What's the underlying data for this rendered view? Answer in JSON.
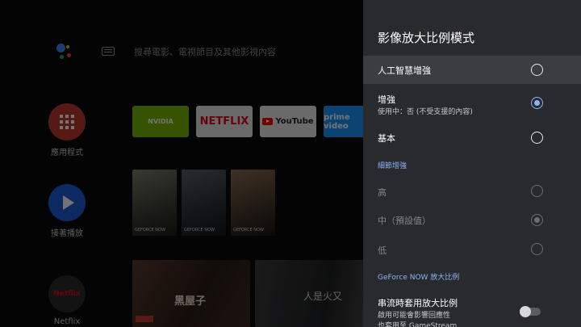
{
  "home": {
    "search_hint": "搜尋電影、電視節目及其他影視內容",
    "side_items": [
      {
        "label": "應用程式",
        "icon": "apps-grid-icon",
        "color": "#c0392b"
      },
      {
        "label": "接著播放",
        "icon": "play-icon",
        "color": "#1e5bd8"
      },
      {
        "label": "Netflix",
        "icon": "netflix-logo-icon",
        "color": "#2a2a2a"
      }
    ],
    "apps": {
      "nvidia": "NVIDIA",
      "netflix": "NETFLIX",
      "youtube": "YouTube",
      "prime": "prime video"
    },
    "games": [
      {
        "badge": "GEFORCE NOW"
      },
      {
        "badge": "GEFORCE NOW"
      },
      {
        "badge": "GEFORCE NOW"
      }
    ],
    "movies": [
      {
        "caption": "黑屋子"
      },
      {
        "caption": "人是火又"
      }
    ]
  },
  "panel": {
    "title": "影像放大比例模式",
    "options": [
      {
        "label": "人工智慧增強",
        "checked": false
      },
      {
        "label": "增強",
        "sub": "使用中：否 (不受支援的內容)",
        "checked": true
      },
      {
        "label": "基本",
        "checked": false
      }
    ],
    "detail_section": {
      "header": "細節增強",
      "options": [
        {
          "label": "高",
          "checked": false
        },
        {
          "label": "中（預設值）",
          "checked": true
        },
        {
          "label": "低",
          "checked": false
        }
      ]
    },
    "geforce_section": {
      "header": "GeForce NOW 放大比例",
      "toggle_label": "串流時套用放大比例",
      "toggle_sub": "啟用可能會影響回應性",
      "toggle_sub2": "也套用至 GameStream",
      "toggle_on": false
    }
  },
  "colors": {
    "panel_bg": "#292a2e",
    "selected_row": "#3c3d41",
    "accent": "#8ab4f8"
  }
}
